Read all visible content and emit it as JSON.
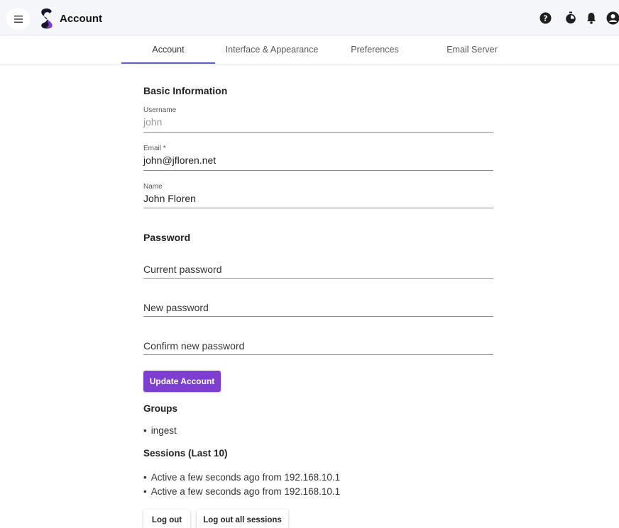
{
  "header": {
    "title": "Account",
    "menu_icon": "hamburger-menu-icon",
    "logo_icon": "app-logo-icon",
    "actions": [
      {
        "icon": "help-icon"
      },
      {
        "icon": "timer-icon"
      },
      {
        "icon": "bell-icon"
      },
      {
        "icon": "account-icon"
      }
    ]
  },
  "tabs": [
    {
      "label": "Account",
      "active": true
    },
    {
      "label": "Interface & Appearance",
      "active": false
    },
    {
      "label": "Preferences",
      "active": false
    },
    {
      "label": "Email Server",
      "active": false
    }
  ],
  "basic_info": {
    "title": "Basic Information",
    "username": {
      "label": "Username",
      "value": "john"
    },
    "email": {
      "label": "Email *",
      "value": "john@jfloren.net"
    },
    "name": {
      "label": "Name",
      "value": "John Floren"
    }
  },
  "password": {
    "title": "Password",
    "current_placeholder": "Current password",
    "new_placeholder": "New password",
    "confirm_placeholder": "Confirm new password"
  },
  "update_button": "Update Account",
  "groups": {
    "title": "Groups",
    "items": [
      "ingest"
    ]
  },
  "sessions": {
    "title": "Sessions (Last 10)",
    "items": [
      "Active a few seconds ago from 192.168.10.1",
      "Active a few seconds ago from 192.168.10.1"
    ]
  },
  "logout_button": "Log out",
  "logout_all_button": "Log out all sessions",
  "colors": {
    "accent": "#7e3fd0",
    "tab_indicator": "#5b5fc7",
    "appbar_bg": "#f4f6fa"
  }
}
